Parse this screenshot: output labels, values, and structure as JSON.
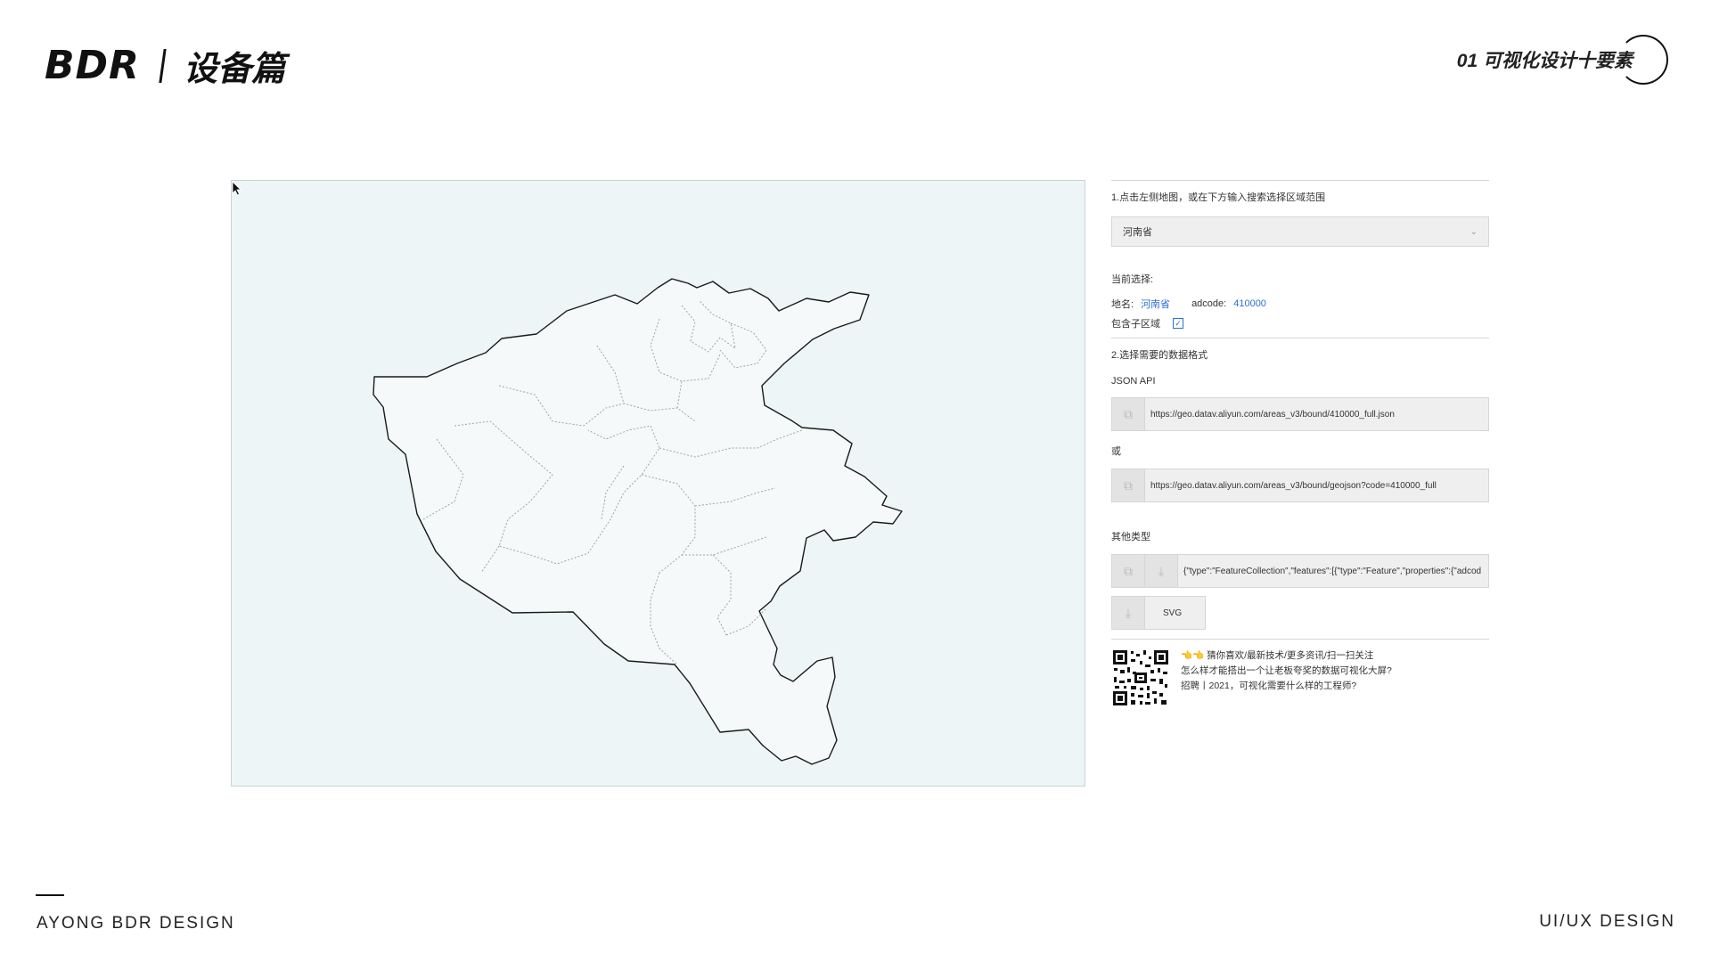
{
  "header": {
    "logo_text": "BDR",
    "subtitle": "设备篇",
    "chapter": "01 可视化设计十要素"
  },
  "panel": {
    "step1": "1.点击左侧地图，或在下方输入搜索选择区域范围",
    "select_value": "河南省",
    "current_label": "当前选择:",
    "name_label": "地名:",
    "name_value": "河南省",
    "adcode_label": "adcode:",
    "adcode_value": "410000",
    "include_label": "包含子区域",
    "step2": "2.选择需要的数据格式",
    "json_api_label": "JSON API",
    "url1": "https://geo.datav.aliyun.com/areas_v3/bound/410000_full.json",
    "or_label": "或",
    "url2": "https://geo.datav.aliyun.com/areas_v3/bound/geojson?code=410000_full",
    "other_label": "其他类型",
    "geojson_preview": "{\"type\":\"FeatureCollection\",\"features\":[{\"type\":\"Feature\",\"properties\":{\"adcod",
    "svg_label": "SVG",
    "promo_1": "👈👈 猜你喜欢/最新技术/更多资讯/扫一扫关注",
    "promo_2": "怎么样才能搭出一个让老板夸奖的数据可视化大屏?",
    "promo_3": "招聘丨2021，可视化需要什么样的工程师?"
  },
  "icons": {
    "copy": "copy-icon",
    "download": "download-icon",
    "chevron": "chevron-down-icon",
    "cursor": "mouse-cursor-icon"
  },
  "colors": {
    "map_bg": "#eef5f6",
    "province_fill": "#f6f9f9",
    "link": "#2c6fd1",
    "accent_red": "#e0262d"
  },
  "footer": {
    "left": "AYONG BDR DESIGN",
    "right": "UI/UX DESIGN"
  }
}
